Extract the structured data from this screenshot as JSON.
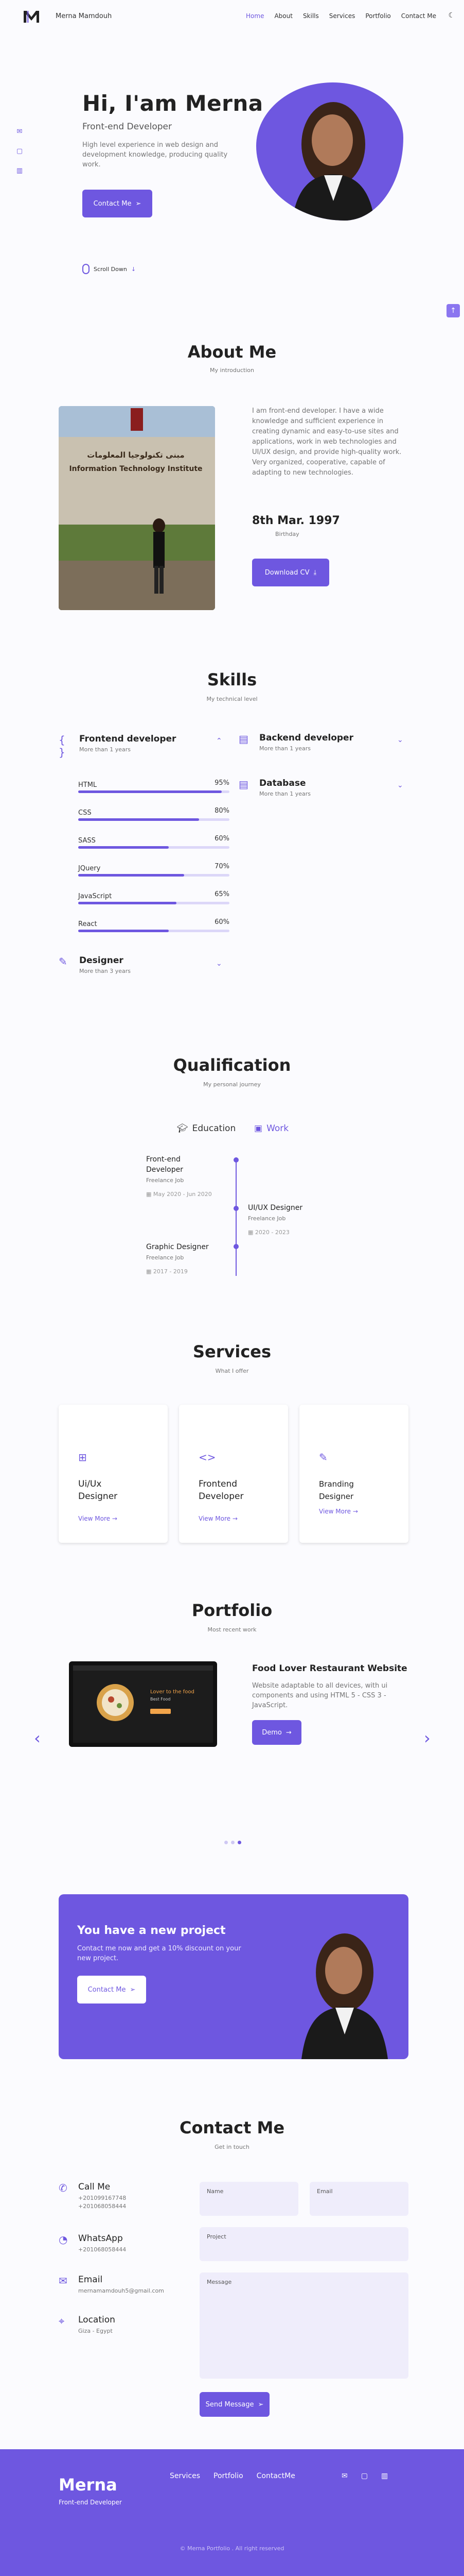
{
  "header": {
    "brand": "Merna Mamdouh",
    "nav": [
      "Home",
      "About",
      "Skills",
      "Services",
      "Portfolio",
      "Contact Me"
    ],
    "active": "Home",
    "logo_icon": "logo-m-icon",
    "theme_icon": "moon-icon"
  },
  "side_social": [
    "mail-icon",
    "chat-icon",
    "linkedin-icon"
  ],
  "hero": {
    "title": "Hi, I'am Merna",
    "subtitle": "Front-end Developer",
    "description": "High level experience in web design and development knowledge, producing quality work.",
    "button": "Contact Me",
    "scroll": "Scroll Down"
  },
  "about": {
    "title": "About Me",
    "subtitle": "My introduction",
    "photo_sign": "مبنى تكنولوجيا المعلومات",
    "photo_sign_en": "Information Technology Institute",
    "text": "I am front-end developer. I have a wide knowledge and sufficient experience in creating dynamic and easy-to-use sites and applications, work in web technologies and UI/UX design, and provide high-quality work. Very organized, cooperative, capable of adapting to new technologies.",
    "birthday": "8th Mar. 1997",
    "birthday_label": "Birthday",
    "cv_button": "Download CV"
  },
  "skills": {
    "title": "Skills",
    "subtitle": "My technical level",
    "groups": [
      {
        "title": "Frontend developer",
        "sub": "More than 1 years"
      },
      {
        "title": "Backend developer",
        "sub": "More than 1 years"
      },
      {
        "title": "Database",
        "sub": "More than 1 years"
      },
      {
        "title": "Designer",
        "sub": "More than 3 years"
      }
    ],
    "bars": [
      {
        "name": "HTML",
        "pct": "95%",
        "value": 95
      },
      {
        "name": "CSS",
        "pct": "80%",
        "value": 80
      },
      {
        "name": "SASS",
        "pct": "60%",
        "value": 60
      },
      {
        "name": "JQuery",
        "pct": "70%",
        "value": 70
      },
      {
        "name": "JavaScript",
        "pct": "65%",
        "value": 65
      },
      {
        "name": "React",
        "pct": "60%",
        "value": 60
      }
    ]
  },
  "qualification": {
    "title": "Qualification",
    "subtitle": "My personal journey",
    "tab_education": "Education",
    "tab_work": "Work",
    "items": [
      {
        "title": "Front-end Developer",
        "sub": "Freelance Job",
        "date": "May 2020 - Jun 2020"
      },
      {
        "title": "UI/UX Designer",
        "sub": "Freelance Job",
        "date": "2020 - 2023"
      },
      {
        "title": "Graphic Designer",
        "sub": "Freelance Job",
        "date": "2017 - 2019"
      }
    ]
  },
  "services": {
    "title": "Services",
    "subtitle": "What I offer",
    "items": [
      {
        "title": "Ui/Ux Designer",
        "more": "View More"
      },
      {
        "title": "Frontend Developer",
        "more": "View More"
      },
      {
        "title": "Branding Designer",
        "more": "View More"
      }
    ]
  },
  "portfolio": {
    "title": "Portfolio",
    "subtitle": "Most recent work",
    "project_title": "Food Lover Restaurant Website",
    "project_desc": "Website adaptable to all devices, with ui components and using HTML 5 - CSS 3 - JavaScript.",
    "button": "Demo",
    "preview_heading": "Lover to the food",
    "preview_sub": "Best Food",
    "dots": 3,
    "active_dot": 3
  },
  "banner": {
    "title": "You have a new project",
    "description": "Contact me now and get a 10% discount on your new project.",
    "button": "Contact Me"
  },
  "contact": {
    "title": "Contact Me",
    "subtitle": "Get in touch",
    "info": [
      {
        "icon": "phone-icon",
        "title": "Call Me",
        "lines": [
          "+201099167748",
          "+201068058444"
        ]
      },
      {
        "icon": "whatsapp-icon",
        "title": "WhatsApp",
        "lines": [
          "+201068058444"
        ]
      },
      {
        "icon": "email-icon",
        "title": "Email",
        "lines": [
          "mernamamdouh5@gmail.com"
        ]
      },
      {
        "icon": "location-icon",
        "title": "Location",
        "lines": [
          "Giza - Egypt"
        ]
      }
    ],
    "fields": {
      "name": "Name",
      "email": "Email",
      "project": "Project",
      "message": "Message"
    },
    "button": "Send Message"
  },
  "footer": {
    "brand": "Merna",
    "sub": "Front-end Developer",
    "links": [
      "Services",
      "Portfolio",
      "ContactMe"
    ],
    "social": [
      "mail-icon",
      "chat-icon",
      "linkedin-icon"
    ],
    "copyright": "© Merna Portfolio . All right reserved"
  },
  "colors": {
    "accent": "#6e57e0",
    "background": "#fbfbfe",
    "text": "#222222"
  }
}
